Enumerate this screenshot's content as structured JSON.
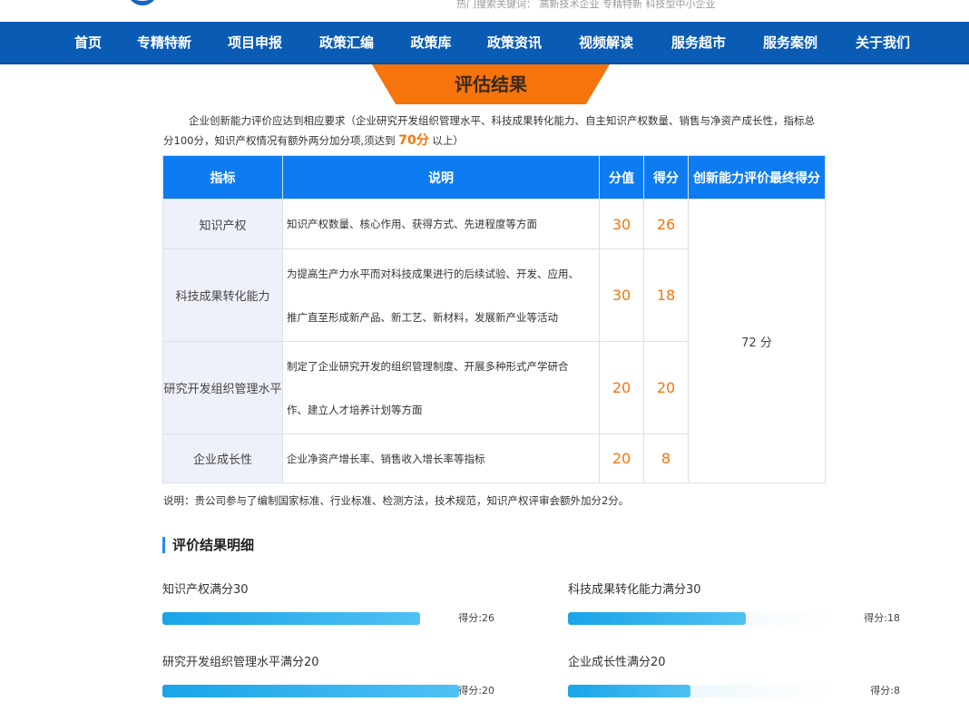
{
  "header": {
    "hot_search": "热门搜索关键词：  高新技术企业  专精特新  科技型中小企业"
  },
  "nav": {
    "items": [
      {
        "label": "首页",
        "center": 97
      },
      {
        "label": "专精特新",
        "center": 181
      },
      {
        "label": "项目申报",
        "center": 281
      },
      {
        "label": "政策汇编",
        "center": 382
      },
      {
        "label": "政策库",
        "center": 475
      },
      {
        "label": "政策资讯",
        "center": 567
      },
      {
        "label": "视频解读",
        "center": 668
      },
      {
        "label": "服务超市",
        "center": 770
      },
      {
        "label": "服务案例",
        "center": 871
      },
      {
        "label": "关于我们",
        "center": 973
      }
    ]
  },
  "result_tab": "评估结果",
  "intro": {
    "text_before": "企业创新能力评价应达到相应要求（企业研究开发组织管理水平、科技成果转化能力、自主知识产权数量、销售与净资产成长性，指标总分100分，知识产权情况有额外两分加分项,须达到 ",
    "highlight": "70分",
    "text_after": " 以上）"
  },
  "table": {
    "headers": {
      "indicator": "指标",
      "description": "说明",
      "max_score": "分值",
      "score": "得分",
      "final": "创新能力评价最终得分"
    },
    "rows": [
      {
        "indicator": "知识产权",
        "desc": [
          "知识产权数量、核心作用、获得方式、先进程度等方面"
        ],
        "max": "30",
        "score": "26"
      },
      {
        "indicator": "科技成果转化能力",
        "desc": [
          "为提高生产力水平而对科技成果进行的后续试验、开发、应用、",
          "推广直至形成新产品、新工艺、新材料，发展新产业等活动"
        ],
        "max": "30",
        "score": "18"
      },
      {
        "indicator": "研究开发组织管理水平",
        "desc": [
          "制定了企业研究开发的组织管理制度、开展多种形式产学研合",
          "作、建立人才培养计划等方面"
        ],
        "max": "20",
        "score": "20"
      },
      {
        "indicator": "企业成长性",
        "desc": [
          "企业净资产增长率、销售收入增长率等指标"
        ],
        "max": "20",
        "score": "8"
      }
    ],
    "final_score": "72 分"
  },
  "note": "说明：贵公司参与了编制国家标准、行业标准、检测方法，技术规范，知识产权评审会额外加分2分。",
  "detail": {
    "title": "评价结果明细",
    "metrics": [
      {
        "label": "知识产权满分30",
        "score_text": "得分:26",
        "fraction": 0.962
      },
      {
        "label": "科技成果转化能力满分30",
        "score_text": "得分:18",
        "fraction": 0.666
      },
      {
        "label": "研究开发组织管理水平满分20",
        "score_text": "得分:20",
        "fraction": 1.11
      },
      {
        "label": "企业成长性满分20",
        "score_text": "得分:8",
        "fraction": 0.456
      }
    ]
  },
  "colors": {
    "nav_bg": "#0a5bb4",
    "accent_orange": "#f5740b",
    "table_header": "#0d7cf2",
    "bar_fill": "#1aa4e8"
  }
}
